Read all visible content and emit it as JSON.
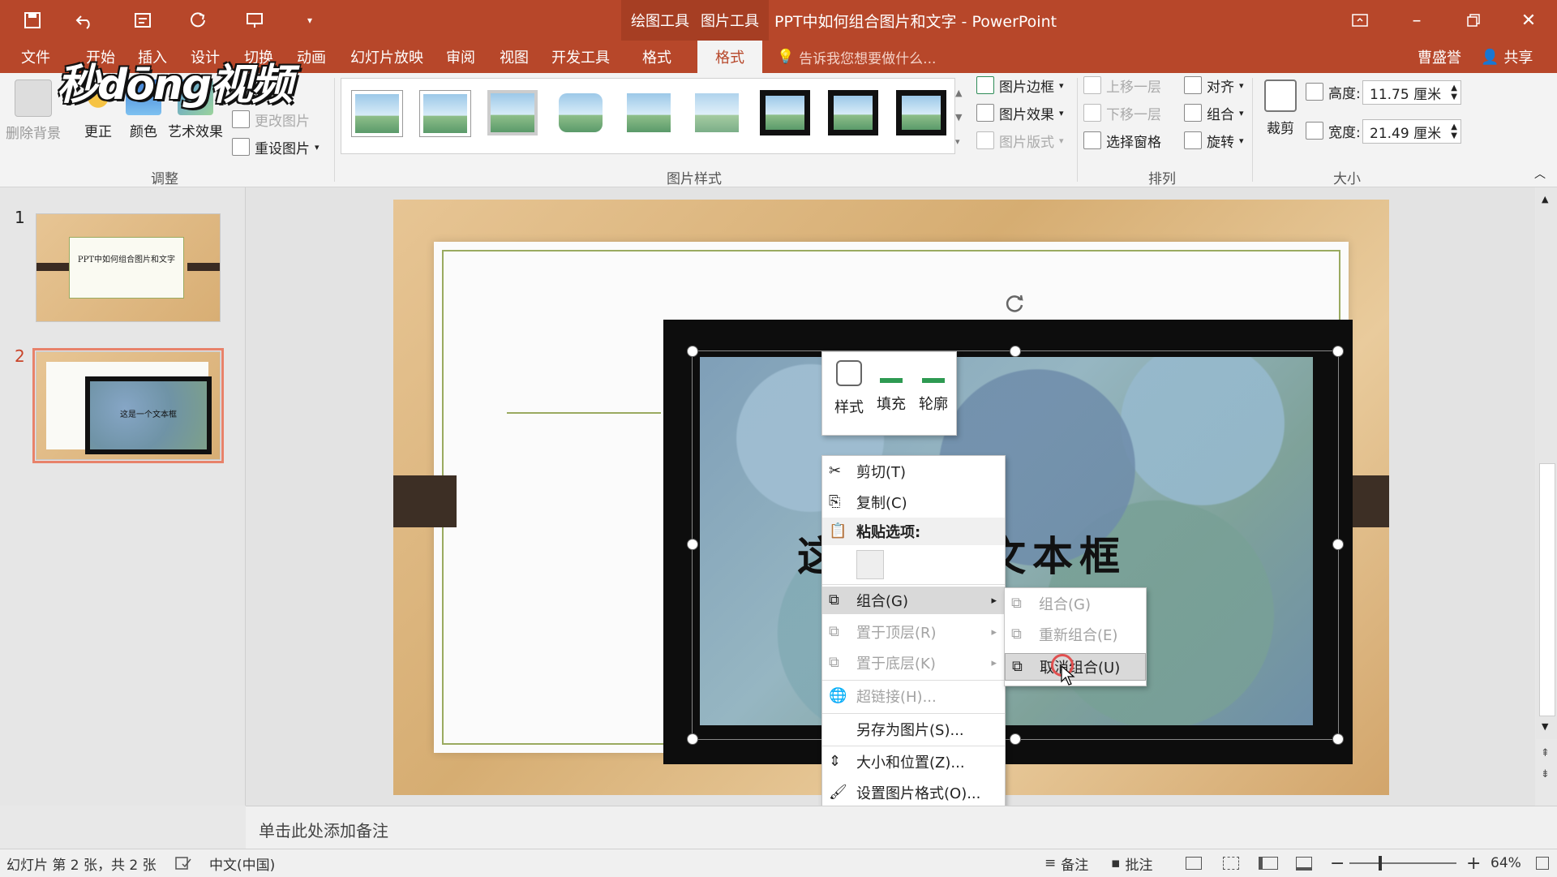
{
  "window": {
    "context_tab_drawing": "绘图工具",
    "context_tab_picture": "图片工具",
    "title": "PPT中如何组合图片和文字 - PowerPoint",
    "user": "曹盛誉",
    "share": "共享"
  },
  "logo_text": "秒dōng视频",
  "ribbon_tabs": [
    "文件",
    "开始",
    "插入",
    "设计",
    "切换",
    "动画",
    "幻灯片放映",
    "审阅",
    "视图",
    "开发工具",
    "格式",
    "格式"
  ],
  "tellme": "告诉我您想要做什么...",
  "ribbon": {
    "adjust": {
      "label": "调整",
      "remove_bg": "删除背景",
      "corrections": "更正",
      "color": "颜色",
      "artistic": "艺术效果",
      "compress": "图片",
      "change": "更改图片",
      "reset": "重设图片"
    },
    "styles": {
      "label": "图片样式",
      "border": "图片边框",
      "effects": "图片效果",
      "layout": "图片版式"
    },
    "arrange": {
      "label": "排列",
      "forward": "上移一层",
      "backward": "下移一层",
      "pane": "选择窗格",
      "align": "对齐",
      "group": "组合",
      "rotate": "旋转"
    },
    "size": {
      "label": "大小",
      "crop": "裁剪",
      "height_label": "高度:",
      "height_value": "11.75 厘米",
      "width_label": "宽度:",
      "width_value": "21.49 厘米"
    }
  },
  "slides": [
    {
      "num": "1",
      "title": "PPT中如何组合图片和文字"
    },
    {
      "num": "2",
      "text": "这是一个文本框"
    }
  ],
  "slide_text": "这是一个文本框",
  "mini_toolbar": {
    "style": "样式",
    "fill": "填充",
    "outline": "轮廓"
  },
  "context_menu": {
    "cut": "剪切(T)",
    "copy": "复制(C)",
    "paste_options": "粘贴选项:",
    "group": "组合(G)",
    "bring_front": "置于顶层(R)",
    "send_back": "置于底层(K)",
    "hyperlink": "超链接(H)...",
    "save_as_picture": "另存为图片(S)...",
    "size_position": "大小和位置(Z)...",
    "format_picture": "设置图片格式(O)..."
  },
  "submenu": {
    "group": "组合(G)",
    "regroup": "重新组合(E)",
    "ungroup": "取消组合(U)"
  },
  "notes_placeholder": "单击此处添加备注",
  "status": {
    "slide_info": "幻灯片 第 2 张，共 2 张",
    "language": "中文(中国)",
    "notes": "备注",
    "comments": "批注",
    "zoom": "64%"
  },
  "colors": {
    "accent": "#b7472a"
  }
}
